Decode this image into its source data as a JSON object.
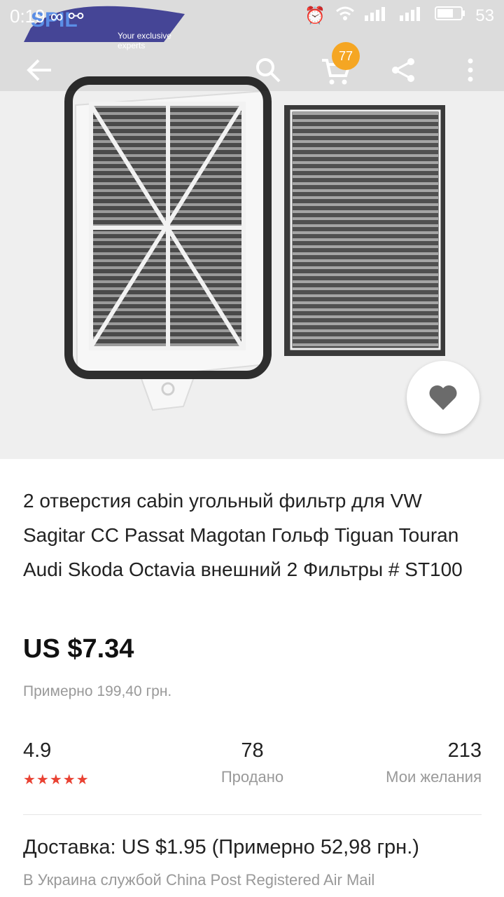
{
  "status": {
    "time": "0:19",
    "left_icons": "∞ ⚯",
    "battery": "53"
  },
  "logo": {
    "tagline": "Your exclusive experts"
  },
  "cart": {
    "count": "77"
  },
  "product": {
    "title": "2 отверстия cabin угольный фильтр для VW Sagitar CC Passat Magotan Гольф Tiguan Touran Audi Skoda Octavia внешний 2 Фильтры # ST100",
    "price": "US $7.34",
    "price_approx": "Примерно 199,40 грн."
  },
  "stats": {
    "rating": "4.9",
    "rating_stars": "★★★★★",
    "sold": "78",
    "sold_label": "Продано",
    "wishes": "213",
    "wishes_label": "Мои желания"
  },
  "delivery": {
    "text": "Доставка: US $1.95 (Примерно 52,98 грн.)",
    "sub": "В Украина службой China Post Registered Air Mail"
  },
  "colors": {
    "accent_red": "#e94233",
    "badge": "#f5a623"
  }
}
